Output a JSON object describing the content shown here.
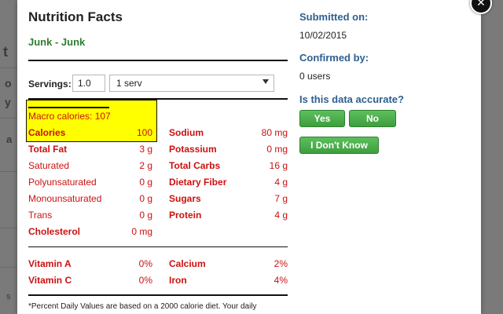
{
  "background": {
    "partial_chars": [
      "t",
      "o",
      "y",
      "a",
      "s"
    ]
  },
  "close_glyph": "✕",
  "nutrition": {
    "title": "Nutrition Facts",
    "food_name": "Junk - Junk",
    "servings_label": "Servings:",
    "servings_value": "1.0",
    "serving_unit": "1 serv",
    "macro_calories": "Macro calories: 107",
    "rows_left": [
      {
        "label": "Calories",
        "value": "100"
      },
      {
        "label": "Total Fat",
        "value": "3 g"
      },
      {
        "label": "Saturated",
        "value": "2 g"
      },
      {
        "label": "Polyunsaturated",
        "value": "0 g"
      },
      {
        "label": "Monounsaturated",
        "value": "0 g"
      },
      {
        "label": "Trans",
        "value": "0 g"
      },
      {
        "label": "Cholesterol",
        "value": "0 mg"
      }
    ],
    "rows_right": [
      {
        "label": "Sodium",
        "value": "80 mg"
      },
      {
        "label": "Potassium",
        "value": "0 mg"
      },
      {
        "label": "Total Carbs",
        "value": "16 g"
      },
      {
        "label": "Dietary Fiber",
        "value": "4 g"
      },
      {
        "label": "Sugars",
        "value": "7 g"
      },
      {
        "label": "Protein",
        "value": "4 g"
      }
    ],
    "vitamins_left": [
      {
        "label": "Vitamin A",
        "value": "0%"
      },
      {
        "label": "Vitamin C",
        "value": "0%"
      }
    ],
    "vitamins_right": [
      {
        "label": "Calcium",
        "value": "2%"
      },
      {
        "label": "Iron",
        "value": "4%"
      }
    ],
    "footnote": "*Percent Daily Values are based on a 2000 calorie diet. Your daily"
  },
  "sidebar": {
    "submitted_label": "Submitted on:",
    "submitted_date": "10/02/2015",
    "confirmed_label": "Confirmed by:",
    "confirmed_count": "0 users",
    "accuracy_label": "Is this data accurate?",
    "yes_label": "Yes",
    "no_label": "No",
    "dont_know_label": "I Don't Know"
  },
  "colors": {
    "nutrient_red": "#cc1111",
    "label_blue": "#2e5f8f",
    "food_green": "#2f7d2f",
    "button_green": "#4caf50",
    "highlight_yellow": "#ffff00"
  }
}
